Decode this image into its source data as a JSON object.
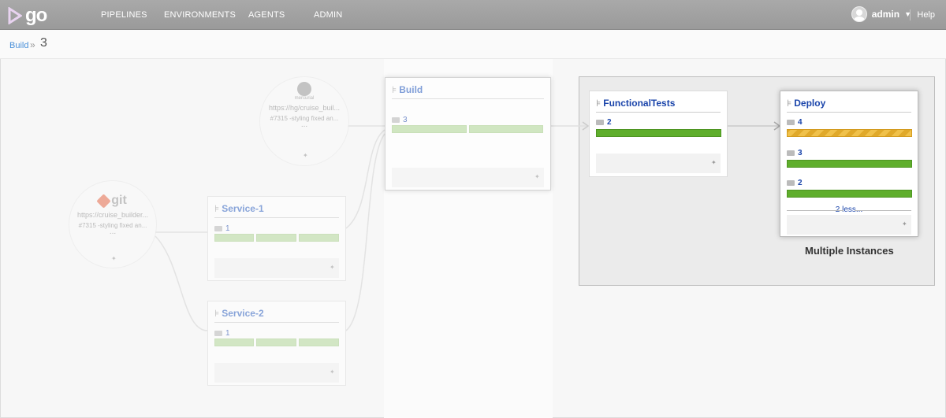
{
  "header": {
    "logo_text": "go",
    "nav": [
      "PIPELINES",
      "ENVIRONMENTS",
      "AGENTS",
      "ADMIN"
    ],
    "user": "admin",
    "help": "Help"
  },
  "breadcrumb": {
    "pipeline": "Build",
    "separator": "»",
    "counter": "3"
  },
  "materials": [
    {
      "logo": "git",
      "url": "https://cruise_builder...",
      "revision": "#7315 -styling fixed an...",
      "more": "..."
    },
    {
      "logo": "mercurial",
      "url": "https://hg/cruise_buil...",
      "revision": "#7315 -styling fixed an...",
      "more": "..."
    }
  ],
  "pipelines": {
    "service1": {
      "name": "Service-1",
      "instance": "1"
    },
    "service2": {
      "name": "Service-2",
      "instance": "1"
    },
    "build": {
      "name": "Build",
      "instance": "3"
    },
    "functional": {
      "name": "FunctionalTests",
      "instance": "2"
    },
    "deploy": {
      "name": "Deploy",
      "instances": [
        "4",
        "3",
        "2"
      ],
      "less_link": "2 less..."
    }
  },
  "caption": "Multiple Instances",
  "colors": {
    "passed": "#5fae2c",
    "building": "#f0c14a",
    "link": "#1a44aa"
  }
}
